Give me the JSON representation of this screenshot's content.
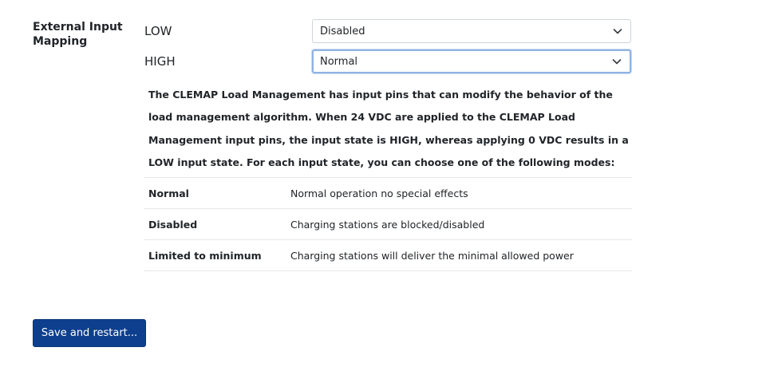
{
  "section": {
    "title": "External Input Mapping"
  },
  "inputs": [
    {
      "label": "LOW",
      "value": "Disabled"
    },
    {
      "label": "HIGH",
      "value": "Normal"
    }
  ],
  "description": "The CLEMAP Load Management has input pins that can modify the behavior of the load management algorithm. When 24 VDC are applied to the CLEMAP Load Management input pins, the input state is HIGH, whereas applying 0 VDC results in a LOW input state. For each input state, you can choose one of the following modes:",
  "modes": [
    {
      "name": "Normal",
      "description": "Normal operation no special effects"
    },
    {
      "name": "Disabled",
      "description": "Charging stations are blocked/disabled"
    },
    {
      "name": "Limited to minimum",
      "description": "Charging stations will deliver the minimal allowed power"
    }
  ],
  "actions": {
    "save_label": "Save and restart..."
  },
  "icons": {
    "select_arrow": "chevron-down-icon"
  },
  "colors": {
    "primary_button": "#0d3f8e",
    "focus_border": "#8fb2e3",
    "text": "#212529"
  }
}
